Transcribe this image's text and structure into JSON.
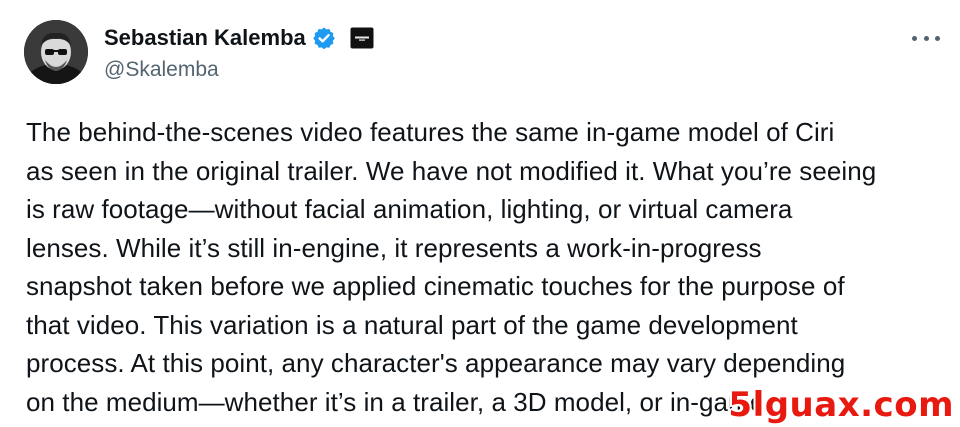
{
  "author": {
    "display_name": "Sebastian Kalemba",
    "handle": "@Skalemba",
    "verified": true,
    "verified_color": "#1d9bf0"
  },
  "icons": {
    "avatar": "profile-photo",
    "verified": "verified-badge-icon",
    "affiliate": "affiliate-badge-icon",
    "more": "more-options-icon"
  },
  "tweet": {
    "lines": [
      "The behind-the-scenes video features the same in-game model of Ciri",
      "as seen in the original trailer. We have not modified it. What you’re seeing",
      "is raw footage—without facial animation, lighting, or virtual camera",
      "lenses. While it’s still in-engine, it represents a work-in-progress",
      "snapshot taken before we applied cinematic touches for the purpose of",
      "that video. This variation is a natural part of the game development",
      "process. At this point, any character's appearance may vary depending",
      "on the medium—whether it’s in a trailer, a 3D model, or in-game."
    ]
  },
  "watermark": {
    "text": "5lguax.com",
    "color": "#e8190f"
  }
}
